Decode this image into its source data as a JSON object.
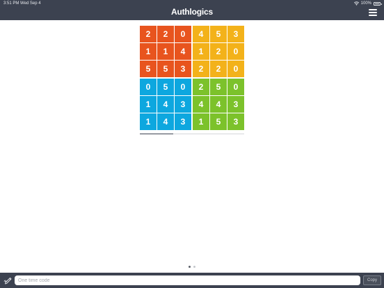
{
  "status_bar": {
    "time_date": "3:51 PM   Wed Sep 4",
    "battery_text": "100%"
  },
  "header": {
    "app_title": "Authlogics",
    "menu_icon": "hamburger-menu-icon"
  },
  "grid": {
    "rows": [
      [
        "2",
        "2",
        "0",
        "4",
        "5",
        "3"
      ],
      [
        "1",
        "1",
        "4",
        "1",
        "2",
        "0"
      ],
      [
        "5",
        "5",
        "3",
        "2",
        "2",
        "0"
      ],
      [
        "0",
        "5",
        "0",
        "2",
        "5",
        "0"
      ],
      [
        "1",
        "4",
        "3",
        "4",
        "4",
        "3"
      ],
      [
        "1",
        "4",
        "3",
        "1",
        "5",
        "3"
      ]
    ],
    "quadrant_colors": {
      "top_left": "#e8541e",
      "top_right": "#f3b21a",
      "bottom_left": "#0da7df",
      "bottom_right": "#7cc22b"
    }
  },
  "timer": {
    "progress": 0.32
  },
  "pager": {
    "pages": 2,
    "active_index": 0
  },
  "footer": {
    "pen_icon": "signature-pen-icon",
    "input_placeholder": "One time code",
    "input_value": "",
    "copy_label": "Copy"
  },
  "colors": {
    "bar": "#3c4250",
    "background": "#ffffff"
  }
}
